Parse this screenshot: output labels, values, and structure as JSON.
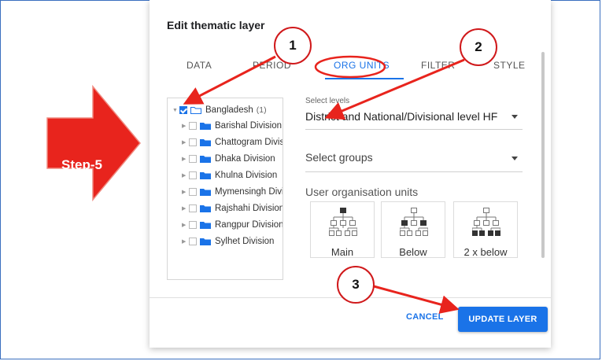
{
  "dialog": {
    "title": "Edit thematic layer",
    "tabs": [
      {
        "label": "DATA"
      },
      {
        "label": "PERIOD"
      },
      {
        "label": "ORG UNITS",
        "active": true
      },
      {
        "label": "FILTER"
      },
      {
        "label": "STYLE"
      }
    ],
    "tree": {
      "root": {
        "label": "Bangladesh",
        "count": "(1)",
        "checked": true
      },
      "children": [
        {
          "label": "Barishal Division"
        },
        {
          "label": "Chattogram Division"
        },
        {
          "label": "Dhaka Division"
        },
        {
          "label": "Khulna Division"
        },
        {
          "label": "Mymensingh Division"
        },
        {
          "label": "Rajshahi Division"
        },
        {
          "label": "Rangpur Division"
        },
        {
          "label": "Sylhet Division"
        }
      ]
    },
    "levels": {
      "label": "Select levels",
      "value": "District and National/Divisional level HF"
    },
    "groups": {
      "placeholder": "Select groups"
    },
    "user_org_units": {
      "title": "User organisation units",
      "options": [
        {
          "label": "Main",
          "icon": "hierarchy-main-icon"
        },
        {
          "label": "Below",
          "icon": "hierarchy-below-icon"
        },
        {
          "label": "2 x below",
          "icon": "hierarchy-2x-below-icon"
        }
      ]
    },
    "actions": {
      "cancel": "CANCEL",
      "update": "UPDATE LAYER"
    }
  },
  "annotations": {
    "step_label": "Step-5",
    "badges": [
      "1",
      "2",
      "3"
    ],
    "colors": {
      "accent": "#1a73e8",
      "annotation_red": "#e8241d",
      "folder": "#1a73e8"
    }
  }
}
